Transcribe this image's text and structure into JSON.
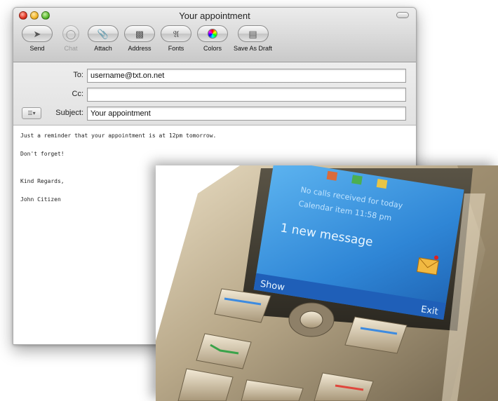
{
  "window": {
    "title": "Your appointment"
  },
  "toolbar": {
    "buttons": [
      {
        "label": "Send",
        "icon": "send-icon"
      },
      {
        "label": "Chat",
        "icon": "chat-icon",
        "disabled": true
      },
      {
        "label": "Attach",
        "icon": "paperclip-icon"
      },
      {
        "label": "Address",
        "icon": "address-book-icon"
      },
      {
        "label": "Fonts",
        "icon": "fonts-icon"
      },
      {
        "label": "Colors",
        "icon": "color-wheel-icon"
      },
      {
        "label": "Save As Draft",
        "icon": "draft-icon"
      }
    ]
  },
  "headers": {
    "to_label": "To:",
    "to_value": "username@txt.on.net",
    "cc_label": "Cc:",
    "cc_value": "",
    "subject_label": "Subject:",
    "subject_value": "Your appointment",
    "account_icon": "list-icon"
  },
  "message": {
    "lines": [
      "Just a reminder that your appointment is at 12pm tomorrow.",
      "Don't forget!",
      "",
      "Kind Regards,",
      "John Citizen"
    ]
  },
  "phone": {
    "notice_1": "No calls received for today",
    "notice_2": "Calendar item 11:58 pm",
    "new_message": "1 new message",
    "soft_left": "Show",
    "soft_right": "Exit",
    "colors": {
      "screen": "#2f86d6",
      "softbar": "#1f5fb8",
      "body": "#b9a98a"
    }
  }
}
